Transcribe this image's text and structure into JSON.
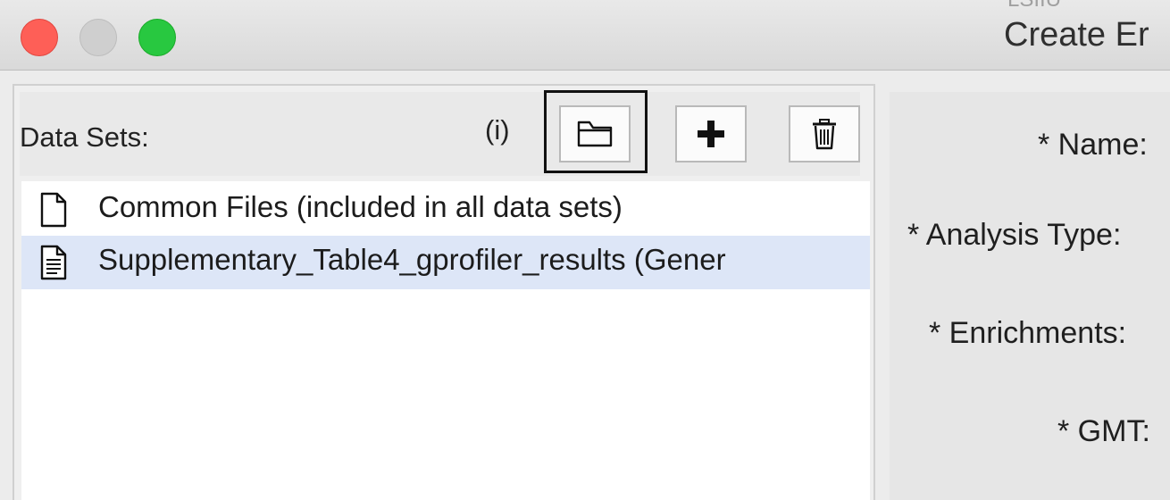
{
  "window": {
    "title": "Create Er",
    "top_artifact": "LSIIU"
  },
  "data_sets": {
    "label": "Data Sets:",
    "info": "(i)",
    "toolbar": {
      "open_folder_icon": "folder-icon",
      "add_icon": "plus-icon",
      "delete_icon": "trash-icon"
    },
    "items": [
      {
        "label": "Common Files (included in all data sets)",
        "icon": "file-icon",
        "selected": false
      },
      {
        "label": "Supplementary_Table4_gprofiler_results  (Gener",
        "icon": "document-icon",
        "selected": true
      }
    ]
  },
  "form": {
    "name_label": "* Name:",
    "analysis_type_label": "* Analysis Type:",
    "enrichments_label": "* Enrichments:",
    "gmt_label": "* GMT:"
  },
  "colors": {
    "close": "#fe5f57",
    "minimize": "#cfcfcf",
    "maximize": "#28c840",
    "selection": "#dde6f7"
  }
}
